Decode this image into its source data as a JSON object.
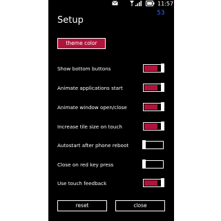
{
  "statusbar": {
    "message_icon": "message-icon",
    "signal_icon": "signal-icon",
    "battery_icon": "battery-icon",
    "time": "11:57"
  },
  "badge": "53",
  "title": "Setup",
  "theme_button": "theme color",
  "settings": [
    {
      "label": "Show bottom buttons",
      "on": true
    },
    {
      "label": "Animate applications start",
      "on": true
    },
    {
      "label": "Animate window open/close",
      "on": true
    },
    {
      "label": "Increase tile size on touch",
      "on": true
    },
    {
      "label": "Autostart after phone reboot",
      "on": false
    },
    {
      "label": "Close on red key press",
      "on": false
    },
    {
      "label": "Use touch feedback",
      "on": true
    }
  ],
  "buttons": {
    "reset": "reset",
    "close": "close"
  },
  "colors": {
    "accent": "#b0133a",
    "background": "#000000",
    "badge": "#2f6bff"
  }
}
